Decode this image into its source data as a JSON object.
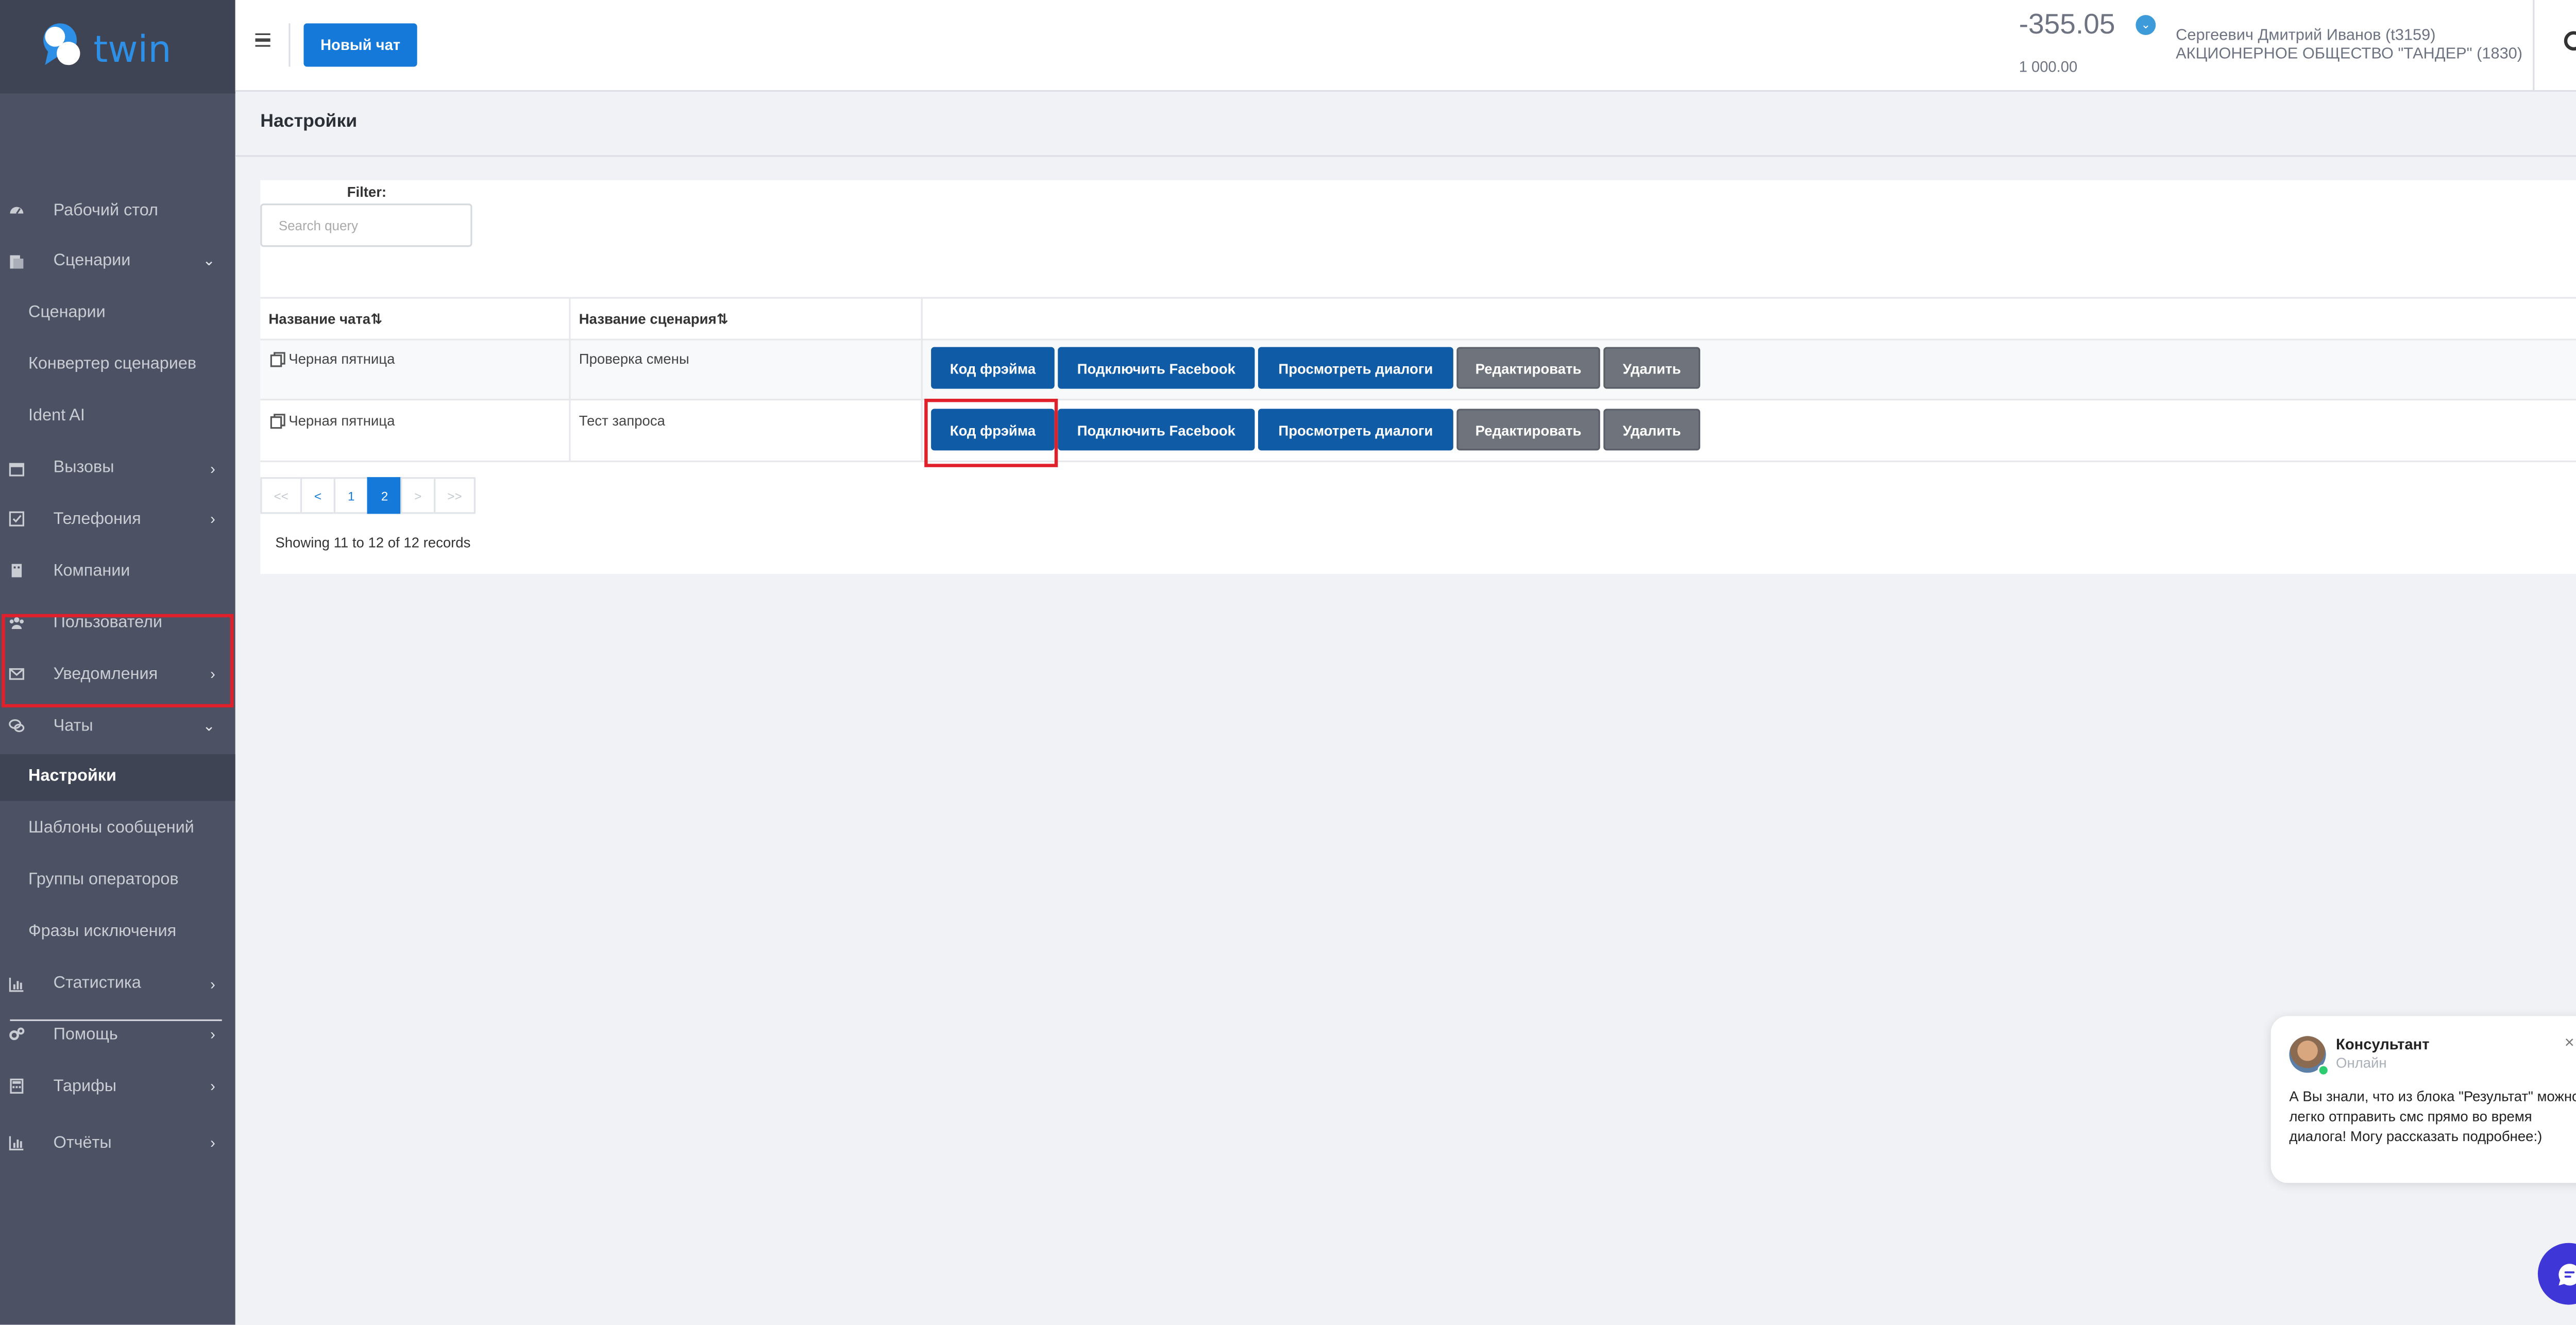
{
  "brand": {
    "logo_text": "twin"
  },
  "sidebar": {
    "items": [
      {
        "label": "Рабочий стол",
        "icon": "dashboard-icon"
      },
      {
        "label": "Сценарии",
        "icon": "scenarios-icon",
        "arrow": "⌄"
      },
      {
        "label": "Сценарии",
        "sub": true
      },
      {
        "label": "Конвертер сценариев",
        "sub": true
      },
      {
        "label": "Ident AI",
        "sub": true
      },
      {
        "label": "Вызовы",
        "icon": "calendar-icon",
        "arrow": "›"
      },
      {
        "label": "Телефония",
        "icon": "check-square-icon",
        "arrow": "›"
      },
      {
        "label": "Компании",
        "icon": "building-icon"
      },
      {
        "label": "Пользователи",
        "icon": "users-icon"
      },
      {
        "label": "Уведомления",
        "icon": "envelope-icon",
        "arrow": "›"
      },
      {
        "label": "Чаты",
        "icon": "chat-icon",
        "arrow": "⌄"
      },
      {
        "label": "Настройки",
        "sub": true,
        "active": true
      },
      {
        "label": "Шаблоны сообщений",
        "sub": true
      },
      {
        "label": "Группы операторов",
        "sub": true
      },
      {
        "label": "Фразы исключения",
        "sub": true
      },
      {
        "label": "Статистика",
        "icon": "chart-icon",
        "arrow": "›"
      },
      {
        "label": "Помощь",
        "icon": "gears-icon",
        "arrow": "›"
      },
      {
        "label": "Тарифы",
        "icon": "calculator-icon",
        "arrow": "›"
      },
      {
        "label": "Отчёты",
        "icon": "chart-icon",
        "arrow": "›"
      }
    ]
  },
  "header": {
    "new_chat": "Новый чат",
    "balance": "-355.05",
    "balance_sub": "1 000.00",
    "user_name": "Сергеевич Дмитрий Иванов (t3159)",
    "user_company": "АКЦИОНЕРНОЕ ОБЩЕСТВО \"ТАНДЕР\" (1830)"
  },
  "page": {
    "title": "Настройки"
  },
  "filter": {
    "label": "Filter:",
    "placeholder": "Search query"
  },
  "table": {
    "columns": [
      "Название чата",
      "Название сценария"
    ],
    "sort_glyph": "⇅",
    "rows": [
      {
        "chat": "Черная пятница",
        "scenario": "Проверка смены"
      },
      {
        "chat": "Черная пятница",
        "scenario": "Тест запроса"
      }
    ],
    "actions": [
      "Код фрэйма",
      "Подключить Facebook",
      "Просмотреть диалоги",
      "Редактировать",
      "Удалить"
    ]
  },
  "pagination": {
    "first": "<<",
    "prev": "<",
    "pages": [
      "1",
      "2"
    ],
    "current": "2",
    "next": ">",
    "last": ">>",
    "showing": "Showing 11 to 12 of 12 records"
  },
  "consultant": {
    "name": "Консультант",
    "status": "Онлайн",
    "close": "×",
    "message": "А Вы знали, что из блока \"Результат\" можно легко отправить смс прямо во время диалога! Могу рассказать подробнее:)"
  },
  "colors": {
    "accent": "#1479d9",
    "sidebar": "#4c5263",
    "highlight": "#e0202a"
  }
}
